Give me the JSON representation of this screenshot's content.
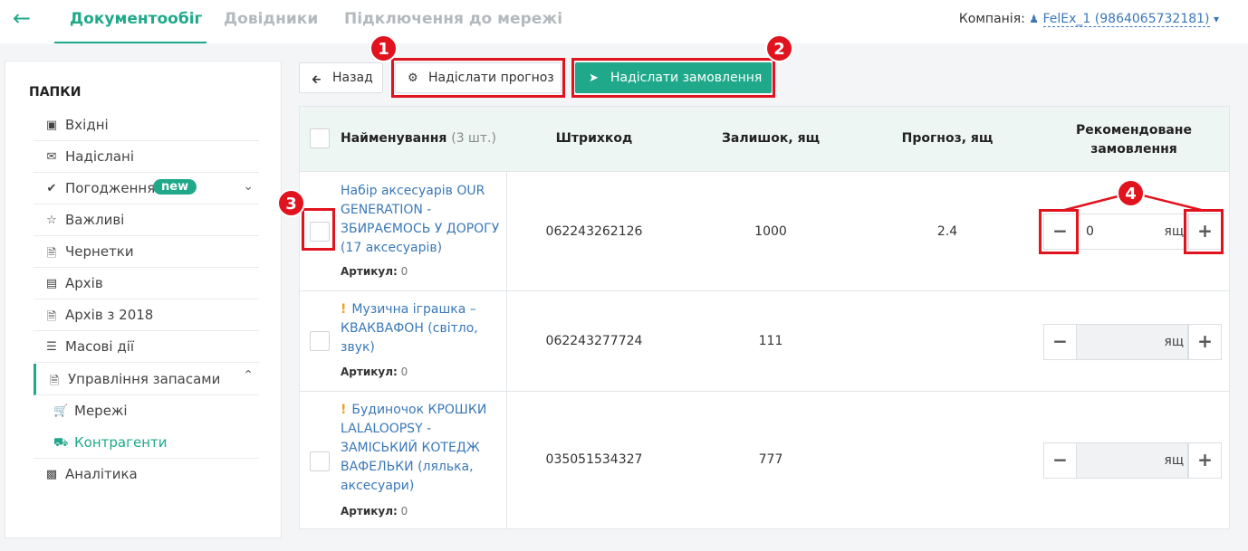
{
  "nav": {
    "tabs": [
      "Документообіг",
      "Довідники",
      "Підключення до мережі"
    ],
    "company_label": "Компанія:",
    "company_value": "FelEx_1 (9864065732181)"
  },
  "sidebar": {
    "title": "ПАПКИ",
    "items": [
      {
        "label": "Вхідні",
        "icon": "inbox-icon"
      },
      {
        "label": "Надіслані",
        "icon": "envelope-icon"
      },
      {
        "label": "Погодження",
        "icon": "check-icon",
        "badge": "new"
      },
      {
        "label": "Важливі",
        "icon": "star-icon"
      },
      {
        "label": "Чернетки",
        "icon": "file-icon"
      },
      {
        "label": "Архів",
        "icon": "archive-icon"
      },
      {
        "label": "Архів з 2018",
        "icon": "file-icon"
      },
      {
        "label": "Масові дії",
        "icon": "list-icon"
      },
      {
        "label": "Управління запасами",
        "icon": "file-icon"
      },
      {
        "label": "Мережі",
        "icon": "cart-icon"
      },
      {
        "label": "Контрагенти",
        "icon": "truck-icon"
      },
      {
        "label": "Аналітика",
        "icon": "bar-chart-icon"
      }
    ]
  },
  "toolbar": {
    "back": "Назад",
    "send_forecast": "Надіслати прогноз",
    "send_order": "Надіслати замовлення"
  },
  "markers": [
    "1",
    "2",
    "3",
    "4"
  ],
  "table": {
    "headers": {
      "name": "Найменування",
      "count": "(3 шт.)",
      "barcode": "Штрихкод",
      "stock": "Залишок, ящ",
      "forecast": "Прогноз, ящ",
      "recommended": "Рекомендоване замовлення"
    },
    "article_label": "Артикул:",
    "unit": "ящ",
    "rows": [
      {
        "name": "Набір аксесуарів OUR GENERATION - ЗБИРАЄМОСЬ У ДОРОГУ (17 аксесуарів)",
        "article": "0",
        "barcode": "062243262126",
        "stock": "1000",
        "forecast": "2.4",
        "order": "0"
      },
      {
        "name": "Музична іграшка – КВАКВАФОН (світло, звук)",
        "article": "0",
        "barcode": "062243277724",
        "stock": "111",
        "forecast": "",
        "order": ""
      },
      {
        "name": "Будиночок КРОШКИ LALALOOPSY - ЗАМІСЬКИЙ КОТЕДЖ ВАФЕЛЬКИ (лялька, аксесуари)",
        "article": "0",
        "barcode": "035051534327",
        "stock": "777",
        "forecast": "",
        "order": ""
      }
    ]
  }
}
